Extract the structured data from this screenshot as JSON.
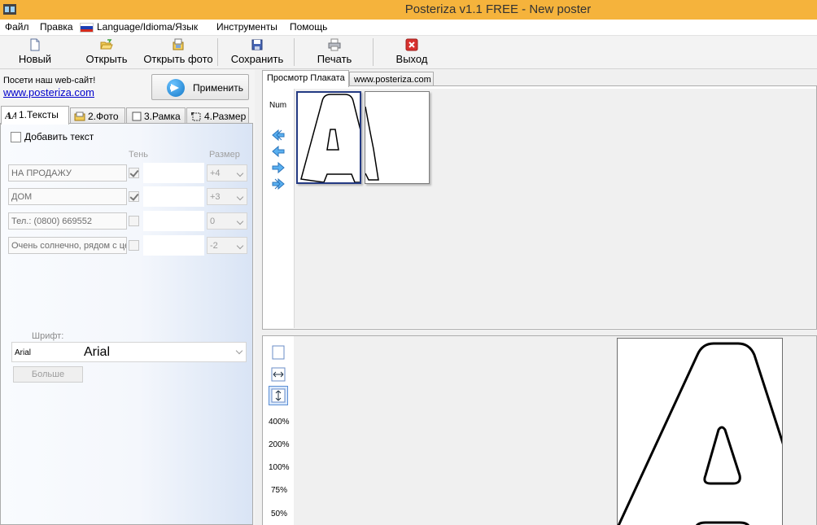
{
  "window": {
    "title": "Posteriza v1.1 FREE - New poster"
  },
  "menu": {
    "file": "Файл",
    "edit": "Правка",
    "language": "Language/Idioma/Язык",
    "tools": "Инструменты",
    "help": "Помощь"
  },
  "toolbar": {
    "new": "Новый",
    "open": "Открыть",
    "open_photo": "Открыть фото",
    "save": "Сохранить",
    "print": "Печать",
    "exit": "Выход"
  },
  "left": {
    "visit_text": "Посети наш web-сайт!",
    "site_link": "www.posteriza.com",
    "apply": "Применить",
    "tabs": [
      "1.Тексты",
      "2.Фото",
      "3.Рамка",
      "4.Размер"
    ],
    "add_text": "Добавить текст",
    "headers": {
      "shadow": "Тень",
      "size": "Размер"
    },
    "rows": [
      {
        "text": "НА ПРОДАЖУ",
        "shadow": true,
        "size": "+4"
      },
      {
        "text": "ДОМ",
        "shadow": true,
        "size": "+3"
      },
      {
        "text": "Тел.: (0800) 669552",
        "shadow": false,
        "size": "0"
      },
      {
        "text": "Очень солнечно, рядом с це",
        "shadow": false,
        "size": "-2"
      }
    ],
    "font_label": "Шрифт:",
    "font_small": "Arial",
    "font_big": "Arial",
    "more": "Больше"
  },
  "right": {
    "tabs": [
      "Просмотр Плаката",
      "www.posteriza.com"
    ],
    "num_label": "Num",
    "zoom_levels": [
      "400%",
      "200%",
      "100%",
      "75%",
      "50%"
    ]
  },
  "colors": {
    "titlebar": "#f5b33c",
    "link": "#0000cc",
    "selection": "#243a83"
  }
}
